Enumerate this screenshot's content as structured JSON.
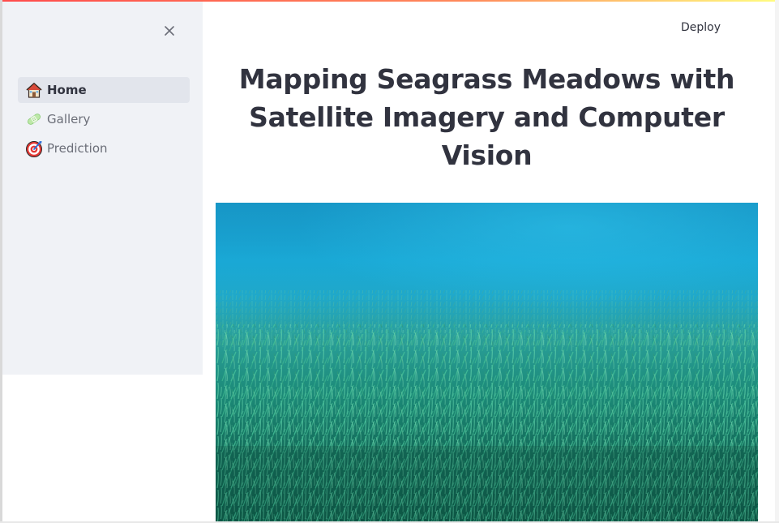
{
  "sidebar": {
    "close_icon": "close-icon",
    "items": [
      {
        "label": "Home",
        "icon": "house-icon",
        "active": true
      },
      {
        "label": "Gallery",
        "icon": "bandage-icon",
        "active": false
      },
      {
        "label": "Prediction",
        "icon": "target-icon",
        "active": false
      }
    ]
  },
  "header": {
    "deploy_label": "Deploy"
  },
  "main": {
    "title": "Mapping Seagrass Meadows with Satellite Imagery and Computer Vision",
    "hero_image": "underwater seagrass meadow photo"
  },
  "colors": {
    "accent_bar_start": "#ff4b4b",
    "accent_bar_end": "#fffd80",
    "sidebar_bg": "#f0f2f6",
    "text": "#31333f"
  }
}
